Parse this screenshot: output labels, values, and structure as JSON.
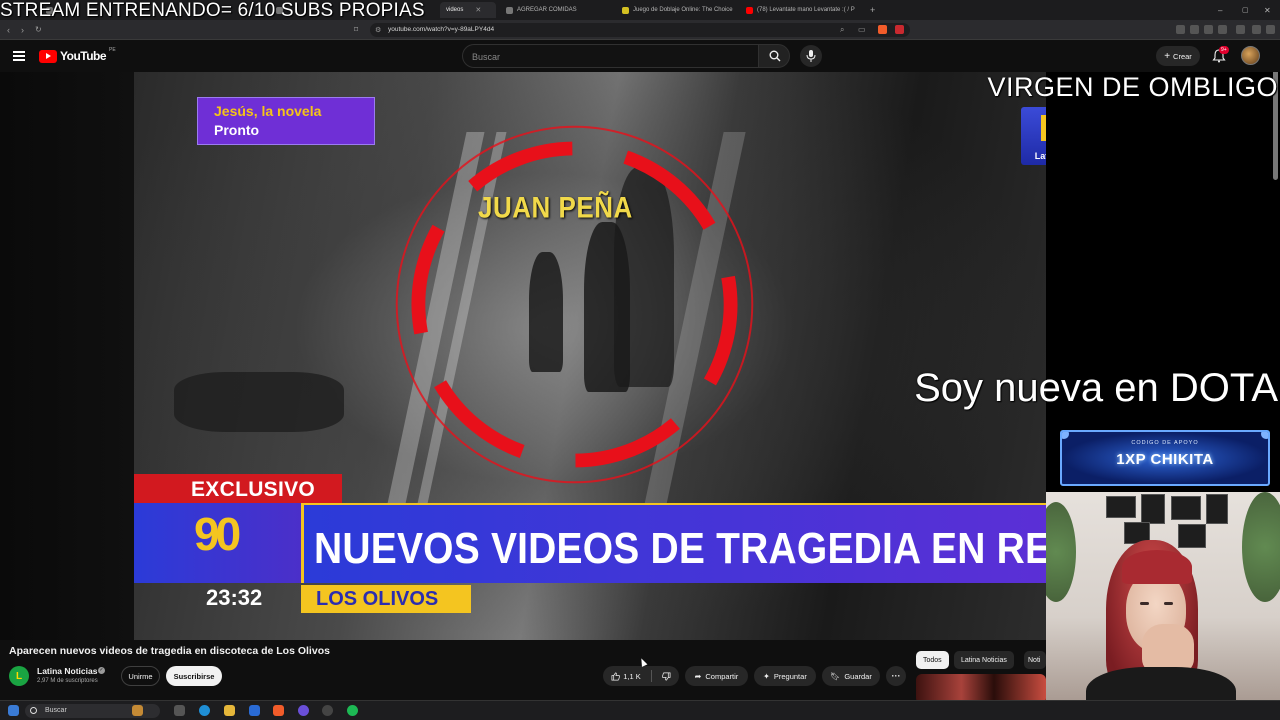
{
  "browser": {
    "tabs": [
      {
        "label": "",
        "active": false,
        "favicon": "#777"
      },
      {
        "label": "",
        "active": false,
        "favicon": "#777"
      },
      {
        "label": "videos",
        "active": true,
        "favicon": "#ff0000"
      },
      {
        "label": "AGREGAR COMIDAS",
        "active": false,
        "favicon": "#777"
      },
      {
        "label": "Juego de Doblaje Online: The Choice",
        "active": false,
        "favicon": "#d4c022"
      },
      {
        "label": "(78) Levantate mano Levantate :( / P",
        "active": false,
        "favicon": "#ff0000"
      }
    ],
    "url": "youtube.com/watch?v=y-89aLPY4d4"
  },
  "overlays": {
    "top_banner": "STREAM ENTRENANDO= 6/10 SUBS PROPIAS",
    "right_top": "VIRGEN DE OMBLIGO",
    "right_mid": "Soy nueva en DOTA",
    "promo_small": "CODIGO DE APOYO",
    "promo_big": "1XP CHIKITA"
  },
  "youtube": {
    "logo": "YouTube",
    "region": "PE",
    "search_placeholder": "Buscar",
    "create_label": "Crear",
    "notif_count": "9+"
  },
  "video_frame": {
    "corner_label_1": "Jesús, la novela",
    "corner_label_2": "Pronto",
    "name_tag": "JUAN PEÑA",
    "channel_logo_text": "Latina",
    "exclusive": "EXCLUSIVO",
    "program": "90",
    "clock": "23:32",
    "headline": "NUEVOS VIDEOS DE TRAGEDIA EN RESTOBA",
    "place": "LOS OLIVOS"
  },
  "video_info": {
    "title": "Aparecen nuevos videos de tragedia en discoteca de Los Olivos",
    "channel": "Latina Noticias",
    "channel_initial": "L",
    "subscribers": "2,97 M de suscriptores",
    "join": "Unirme",
    "subscribe": "Suscribirse",
    "likes": "1,1 K",
    "share": "Compartir",
    "ask": "Preguntar",
    "save": "Guardar"
  },
  "chips": [
    "Todos",
    "Latina Noticias",
    "Noti"
  ],
  "taskbar": {
    "search": "Buscar"
  },
  "colors": {
    "yt_red": "#ff0000",
    "headline_blue": "#2b3bd8",
    "accent_yellow": "#f4c520",
    "exclusive_red": "#d2191f",
    "ring_red": "#e8101a"
  }
}
